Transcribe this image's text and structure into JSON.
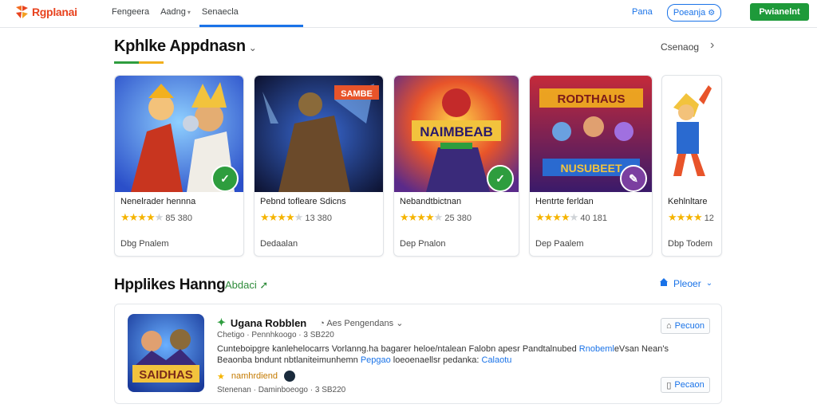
{
  "brand": {
    "name": "Rgplanai",
    "accent": "#e8431f"
  },
  "nav": {
    "items": [
      {
        "label": "Fengeera",
        "caret": false
      },
      {
        "label": "Aadng",
        "caret": true
      },
      {
        "label": "Senaecla",
        "caret": false
      }
    ]
  },
  "top_right": {
    "link": "Pana",
    "pill": "Poeanja",
    "button": "Pwianelnt"
  },
  "section1": {
    "title": "Kphlke Appdnasn",
    "see_more": "Csenaog"
  },
  "cards": [
    {
      "name": "Nenelrader hennna",
      "stars": 4,
      "rating_text": "85 380",
      "footer": "Dbg Pnalem",
      "badge_color": "#2e9d3e",
      "badge_icon": "check-icon"
    },
    {
      "name": "Pebnd tofleare Sdicns",
      "stars": 4,
      "rating_text": "13 380",
      "footer": "Dedaalan",
      "badge_color": null,
      "badge_icon": null
    },
    {
      "name": "Nebandtbictnan",
      "stars": 4,
      "rating_text": "25 380",
      "footer": "Dep Pnalon",
      "badge_color": "#2e9d3e",
      "badge_icon": "check-icon"
    },
    {
      "name": "Hentrte ferldan",
      "stars": 4,
      "rating_text": "40 181",
      "footer": "Dep Paalem",
      "badge_color": "#7b3fa0",
      "badge_icon": "pencil-icon"
    },
    {
      "name": "Kehlnltare",
      "stars": 4,
      "rating_text": "12",
      "footer": "Dbp Todem",
      "badge_color": null,
      "badge_icon": null
    }
  ],
  "section2": {
    "title": "Hpplikes Hanng",
    "subtitle": "Abdaci",
    "right_label": "Pleoer"
  },
  "list_item": {
    "title": "Ugana Robblen",
    "meta": "Aes Pengendans",
    "line1": "Chetigo · Pennhkoogo · 3 SB220",
    "desc_parts": [
      {
        "text": "Cunteboipgre kanlehelocarrs Vorlanng.ha bagarer heloe/ntalean Falobn apesr  Pandtalnubed ",
        "hl": false
      },
      {
        "text": "Rnobeml",
        "hl": true
      },
      {
        "text": "eVsan Nean's Beaonba bndunt nbtlaniteimunhemn ",
        "hl": false
      },
      {
        "text": "Pepgao",
        "hl": true
      },
      {
        "text": " loeoenaellsr pedanka: ",
        "hl": false
      },
      {
        "text": "Calaotu",
        "hl": true
      }
    ],
    "tag": "namhrdiend",
    "line2": "Stenenan · Daminboeogo · 3 SB220",
    "button1": "Pecuon",
    "button2": "Pecaon"
  }
}
